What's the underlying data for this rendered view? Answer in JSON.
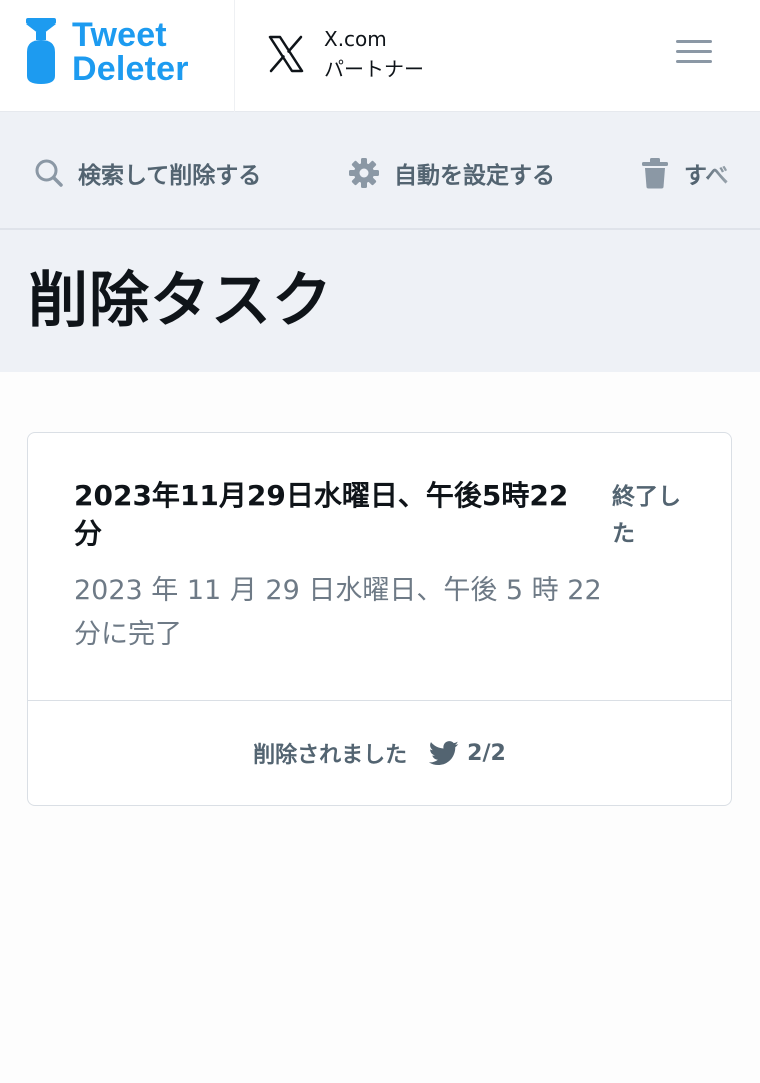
{
  "header": {
    "logo_line1": "Tweet",
    "logo_line2": "Deleter",
    "partner_line1": "X.com",
    "partner_line2": "パートナー"
  },
  "toolbar": {
    "search_delete": "検索して削除する",
    "auto_settings": "自動を設定する",
    "delete_all_partial": "すべ"
  },
  "page": {
    "title": "削除タスク"
  },
  "task": {
    "title": "2023年11月29日水曜日、午後5時22分",
    "status": "終了した",
    "completed_text": "2023 年 11 月 29 日水曜日、午後 5 時 22 分に完了",
    "deleted_label": "削除されました",
    "deleted_count": "2/2"
  },
  "colors": {
    "brand_blue": "#1d9bf0",
    "muted_gray": "#536471",
    "band_bg": "#eef1f6"
  }
}
